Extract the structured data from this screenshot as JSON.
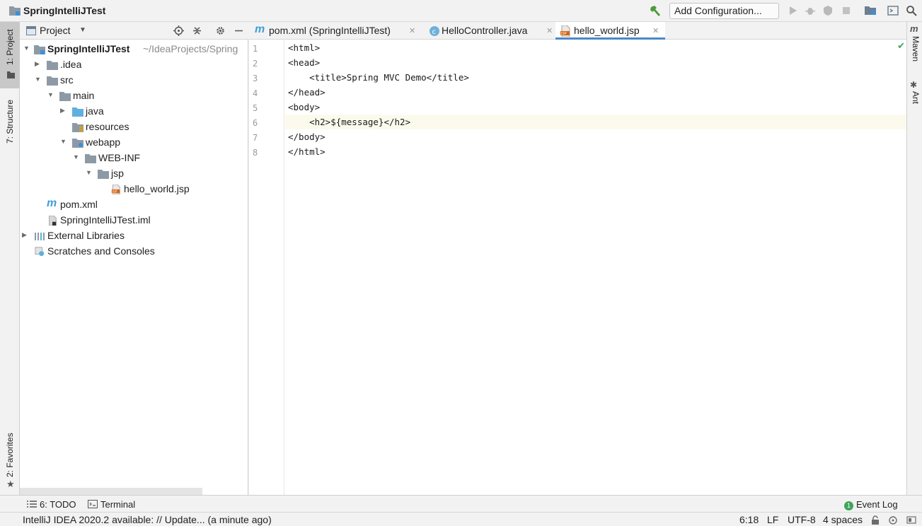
{
  "window": {
    "project_name": "SpringIntelliJTest",
    "add_configuration": "Add Configuration..."
  },
  "left_strip": {
    "project_tab": "1: Project",
    "structure_tab": "7: Structure",
    "favorites_tab": "2: Favorites"
  },
  "project_panel": {
    "title": "Project",
    "tree": [
      {
        "label": "SpringIntelliJTest",
        "path": "~/IdeaProjects/Spring",
        "bold": true
      },
      {
        "label": ".idea"
      },
      {
        "label": "src"
      },
      {
        "label": "main"
      },
      {
        "label": "java"
      },
      {
        "label": "resources"
      },
      {
        "label": "webapp"
      },
      {
        "label": "WEB-INF"
      },
      {
        "label": "jsp"
      },
      {
        "label": "hello_world.jsp"
      },
      {
        "label": "pom.xml"
      },
      {
        "label": "SpringIntelliJTest.iml"
      },
      {
        "label": "External Libraries"
      },
      {
        "label": "Scratches and Consoles"
      }
    ]
  },
  "editor": {
    "tabs": [
      {
        "label": "pom.xml (SpringIntelliJTest)",
        "icon": "maven-icon"
      },
      {
        "label": "HelloController.java",
        "icon": "java-class-icon"
      },
      {
        "label": "hello_world.jsp",
        "icon": "jsp-file-icon",
        "active": true
      }
    ],
    "line_numbers": [
      "1",
      "2",
      "3",
      "4",
      "5",
      "6",
      "7",
      "8"
    ],
    "lines": [
      "<html>",
      "<head>",
      "    <title>Spring MVC Demo</title>",
      "</head>",
      "<body>",
      "    <h2>${message}</h2>",
      "</body>",
      "</html>"
    ],
    "current_line": 6
  },
  "right_strip": {
    "maven": "Maven",
    "ant": "Ant"
  },
  "bottom_tools": {
    "todo": "6: TODO",
    "terminal": "Terminal",
    "event_log": "Event Log",
    "event_log_count": "1"
  },
  "status_bar": {
    "message": "IntelliJ IDEA 2020.2 available: // Update... (a minute ago)",
    "position": "6:18",
    "line_separator": "LF",
    "encoding": "UTF-8",
    "indent": "4 spaces"
  },
  "colors": {
    "accent": "#4a88c7",
    "folder": "#8d9aa6",
    "source_folder": "#5fb0df",
    "current_line": "#fcfaed",
    "check": "#3fa45a"
  }
}
